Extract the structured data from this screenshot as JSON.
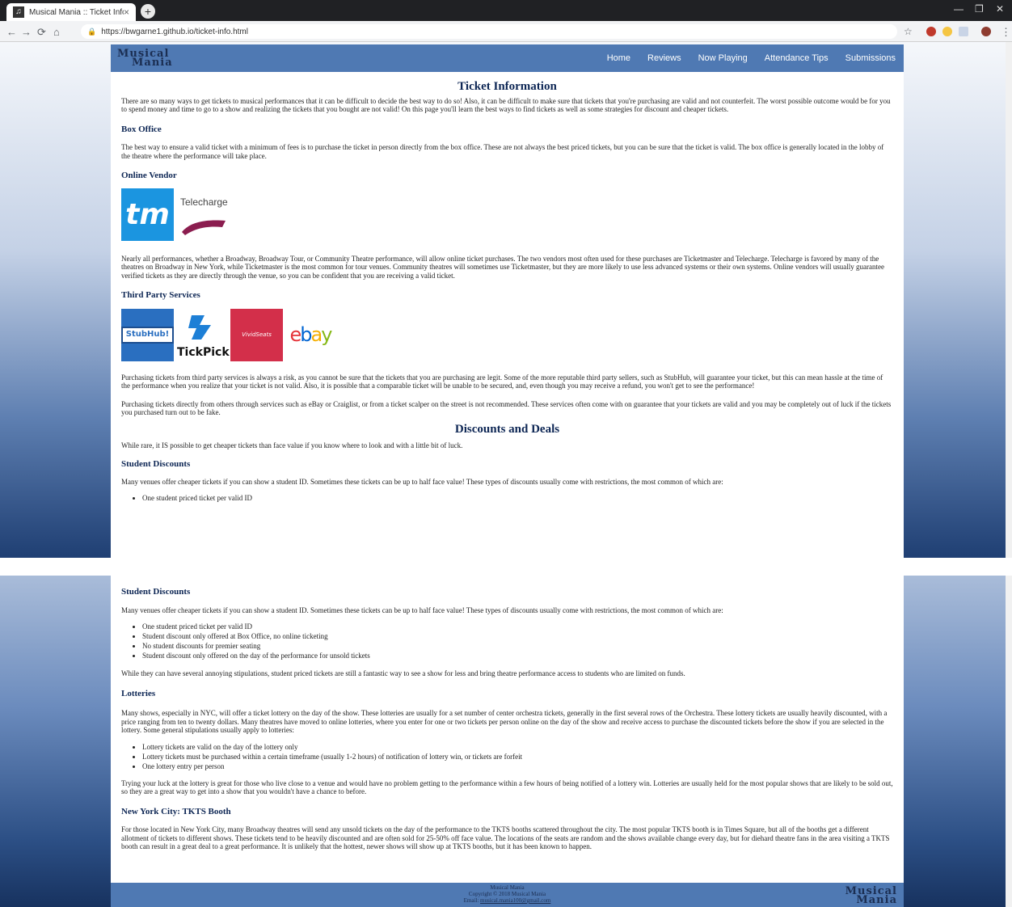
{
  "browser": {
    "tab_title": "Musical Mania :: Ticket Info",
    "tab_close": "×",
    "new_tab": "+",
    "url": "https://bwgarne1.github.io/ticket-info.html"
  },
  "site": {
    "logo_line1": "Musical",
    "logo_line2": "Mania",
    "nav": [
      "Home",
      "Reviews",
      "Now Playing",
      "Attendance Tips",
      "Submissions"
    ]
  },
  "page_title": "Ticket Information",
  "intro": "There are so many ways to get tickets to musical performances that it can be difficult to decide the best way to do so! Also, it can be difficult to make sure that tickets that you're purchasing are valid and not counterfeit. The worst possible outcome would be for you to spend money and time to go to a show and realizing the tickets that you bought are not valid! On this page you'll learn the best ways to find tickets as well as some strategies for discount and cheaper tickets.",
  "box_office": {
    "heading": "Box Office",
    "text": "The best way to ensure a valid ticket with a minimum of fees is to purchase the ticket in person directly from the box office. These are not always the best priced tickets, but you can be sure that the ticket is valid. The box office is generally located in the lobby of the theatre where the performance will take place."
  },
  "online_vendor": {
    "heading": "Online Vendor",
    "logo_tm": "tm",
    "logo_telecharge": "Telecharge",
    "text": "Nearly all performances, whether a Broadway, Broadway Tour, or Community Theatre performance, will allow online ticket purchases. The two vendors most often used for these purchases are Ticketmaster and Telecharge. Telecharge is favored by many of the theatres on Broadway in New York, while Ticketmaster is the most common for tour venues. Community theatres will sometimes use Ticketmaster, but they are more likely to use less advanced systems or their own systems. Online vendors will usually guarantee verified tickets as they are directly through the venue, so you can be confident that you are receiving a valid ticket."
  },
  "third_party": {
    "heading": "Third Party Services",
    "logo_stubhub": "StubHub!",
    "logo_tickpick": "TickPick",
    "logo_vivid": "VividSeats",
    "logo_ebay": [
      "e",
      "b",
      "a",
      "y"
    ],
    "text1": "Purchasing tickets from third party services is always a risk, as you cannot be sure that the tickets that you are purchasing are legit. Some of the more reputable third party sellers, such as StubHub, will guarantee your ticket, but this can mean hassle at the time of the performance when you realize that your ticket is not valid. Also, it is possible that a comparable ticket will be unable to be secured, and, even though you may receive a refund, you won't get to see the performance!",
    "text2": "Purchasing tickets directly from others through services such as eBay or Craiglist, or from a ticket scalper on the street is not recommended. These services often come with on guarantee that your tickets are valid and you may be completely out of luck if the tickets you purchased turn out to be fake."
  },
  "discounts": {
    "heading": "Discounts and Deals",
    "intro": "While rare, it IS possible to get cheaper tickets than face value if you know where to look and with a little bit of luck."
  },
  "student": {
    "heading": "Student Discounts",
    "text": "Many venues offer cheaper tickets if you can show a student ID. Sometimes these tickets can be up to half face value! These types of discounts usually come with restrictions, the most common of which are:",
    "items": [
      "One student priced ticket per valid ID",
      "Student discount only offered at Box Office, no online ticketing",
      "No student discounts for premier seating",
      "Student discount only offered on the day of the performance for unsold tickets"
    ],
    "after": "While they can have several annoying stipulations, student priced tickets are still a fantastic way to see a show for less and bring theatre performance access to students who are limited on funds."
  },
  "lotteries": {
    "heading": "Lotteries",
    "text": "Many shows, especially in NYC, will offer a ticket lottery on the day of the show. These lotteries are usually for a set number of center orchestra tickets, generally in the first several rows of the Orchestra. These lottery tickets are usually heavily discounted, with a price ranging from ten to twenty dollars. Many theatres have moved to online lotteries, where you enter for one or two tickets per person online on the day of the show and receive access to purchase the discounted tickets before the show if you are selected in the lottery. Some general stipulations usually apply to lotteries:",
    "items": [
      "Lottery tickets are valid on the day of the lottery only",
      "Lottery tickets must be purchased within a certain timeframe (usually 1-2 hours) of notification of lottery win, or tickets are forfeit",
      "One lottery entry per person"
    ],
    "after": "Trying your luck at the lottery is great for those who live close to a venue and would have no problem getting to the performance within a few hours of being notified of a lottery win. Lotteries are usually held for the most popular shows that are likely to be sold out, so they are a great way to get into a show that you wouldn't have a chance to before."
  },
  "tkts": {
    "heading": "New York City: TKTS Booth",
    "text": "For those located in New York City, many Broadway theatres will send any unsold tickets on the day of the performance to the TKTS booths scattered throughout the city. The most popular TKTS booth is in Times Square, but all of the booths get a different allotment of tickets to different shows. These tickets tend to be heavily discounted and are often sold for 25-50% off face value. The locations of the seats are random and the shows available change every day, but for diehard theatre fans in the area visiting a TKTS booth can result in a great deal to a great performance. It is unlikely that the hottest, newer shows will show up at TKTS booths, but it has been known to happen."
  },
  "footer": {
    "line1": "Musical Mania",
    "line2": "Copyright © 2018 Musical Mania",
    "email_label": "Email: ",
    "email": "musical.mania100@gmail.com"
  },
  "colors": {
    "nav_bg": "#4f79b3",
    "heading": "#0d2654",
    "tm_blue": "#1b95e0",
    "telecharge_ribbon": "#8b1d4f",
    "stubhub_blue": "#2a6fc0",
    "vivid_red": "#d32f4a"
  }
}
